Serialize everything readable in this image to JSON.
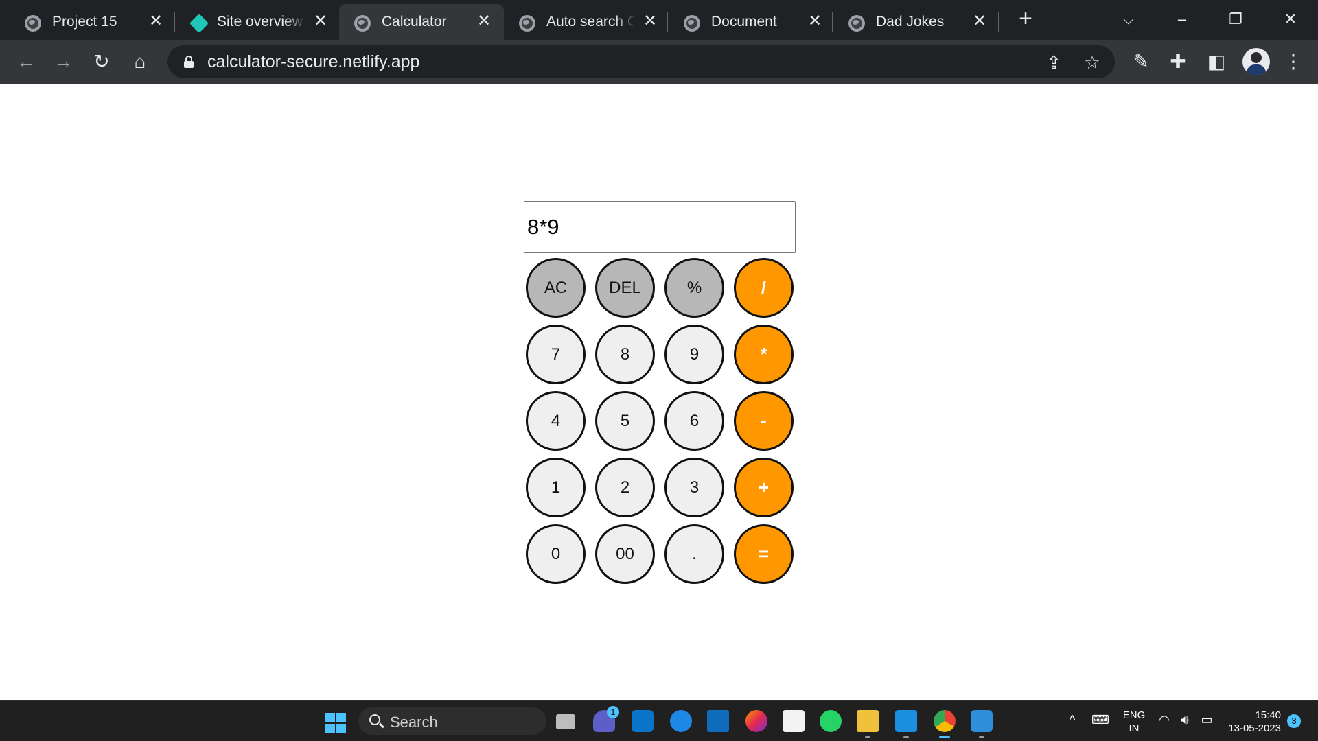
{
  "browser": {
    "tabs": [
      {
        "title": "Project 15",
        "icon": "globe-icon",
        "active": false
      },
      {
        "title": "Site overview",
        "icon": "netlify-icon",
        "active": false
      },
      {
        "title": "Calculator",
        "icon": "globe-icon",
        "active": true
      },
      {
        "title": "Auto search C",
        "icon": "globe-icon",
        "active": false
      },
      {
        "title": "Document",
        "icon": "globe-icon",
        "active": false
      },
      {
        "title": "Dad Jokes",
        "icon": "globe-icon",
        "active": false
      }
    ],
    "url": "calculator-secure.netlify.app",
    "close_glyph": "✕",
    "new_tab_glyph": "+"
  },
  "calculator": {
    "display": "8*9",
    "keys": [
      "AC",
      "DEL",
      "%",
      "/",
      "7",
      "8",
      "9",
      "*",
      "4",
      "5",
      "6",
      "-",
      "1",
      "2",
      "3",
      "+",
      "0",
      "00",
      ".",
      "="
    ],
    "colors": {
      "function_key": "#b7b7b7",
      "digit_key": "#efefef",
      "operator_key": "#ff9800"
    }
  },
  "taskbar": {
    "search_label": "Search",
    "teams_badge": "1",
    "language_line1": "ENG",
    "language_line2": "IN",
    "time": "15:40",
    "date": "13-05-2023",
    "notification_count": "3"
  }
}
